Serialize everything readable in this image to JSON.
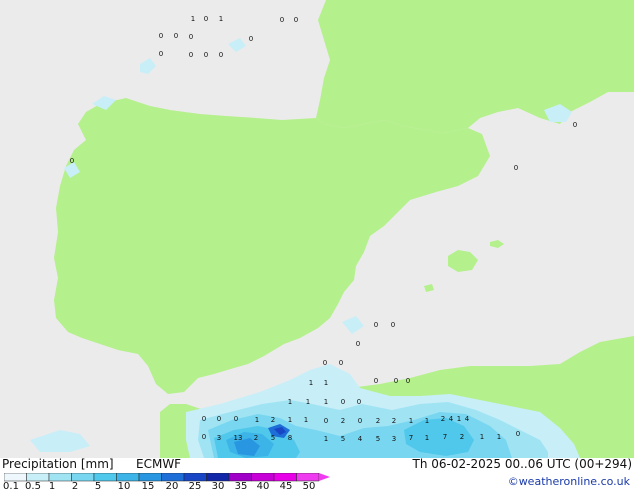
{
  "header": {
    "legend_title": "Precipitation [mm]",
    "model": "ECMWF",
    "valid_time": "Th 06-02-2025 00..06 UTC (00+294)"
  },
  "credit": "©weatheronline.co.uk",
  "legend": {
    "ticks": [
      "0.1",
      "0.5",
      "1",
      "2",
      "5",
      "10",
      "15",
      "20",
      "25",
      "30",
      "35",
      "40",
      "45",
      "50"
    ],
    "colors": [
      "#eef8fc",
      "#c8eef8",
      "#a0e4f4",
      "#78d6f0",
      "#50c8ec",
      "#3cb4e8",
      "#2896e0",
      "#1e6ed8",
      "#1846c4",
      "#1226a8",
      "#a000c8",
      "#c800d8",
      "#e800e8",
      "#f03cf0"
    ]
  },
  "map": {
    "land_color": "#b4f08c",
    "sea_color": "#ebebeb",
    "values": [
      "1",
      "0",
      "1",
      "0",
      "0",
      "0",
      "0",
      "0",
      "0",
      "0",
      "0",
      "0",
      "0",
      "0",
      "0",
      "0",
      "0",
      "0",
      "0",
      "0",
      "0",
      "1",
      "0",
      "0",
      "0",
      "1",
      "1",
      "1",
      "0",
      "0",
      "1",
      "0",
      "0",
      "0",
      "1",
      "1",
      "2",
      "1",
      "2",
      "0",
      "0",
      "2",
      "2",
      "1",
      "1",
      "2",
      "1",
      "4",
      "4",
      "0",
      "3",
      "13",
      "2",
      "5",
      "8",
      "1",
      "5",
      "4",
      "5",
      "3",
      "7",
      "1",
      "7",
      "2",
      "1",
      "1",
      "0"
    ]
  }
}
